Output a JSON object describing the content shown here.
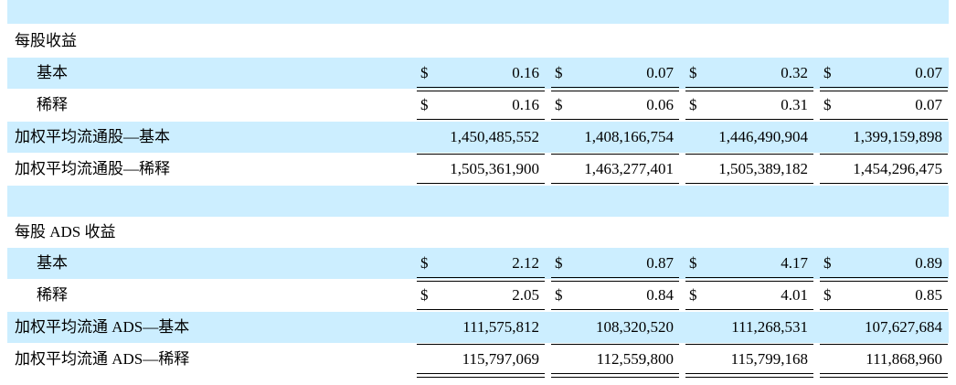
{
  "sections": [
    {
      "title": "每股收益",
      "rows": [
        {
          "label": "基本",
          "currency": "$",
          "values": [
            "0.16",
            "0.07",
            "0.32",
            "0.07"
          ]
        },
        {
          "label": "稀释",
          "currency": "$",
          "values": [
            "0.16",
            "0.06",
            "0.31",
            "0.07"
          ]
        },
        {
          "label": "加权平均流通股—基本",
          "currency": "",
          "values": [
            "1,450,485,552",
            "1,408,166,754",
            "1,446,490,904",
            "1,399,159,898"
          ]
        },
        {
          "label": "加权平均流通股—稀释",
          "currency": "",
          "values": [
            "1,505,361,900",
            "1,463,277,401",
            "1,505,389,182",
            "1,454,296,475"
          ]
        }
      ]
    },
    {
      "title": "每股 ADS 收益",
      "rows": [
        {
          "label": "基本",
          "currency": "$",
          "values": [
            "2.12",
            "0.87",
            "4.17",
            "0.89"
          ]
        },
        {
          "label": "稀释",
          "currency": "$",
          "values": [
            "2.05",
            "0.84",
            "4.01",
            "0.85"
          ]
        },
        {
          "label": "加权平均流通 ADS—基本",
          "currency": "",
          "values": [
            "111,575,812",
            "108,320,520",
            "111,268,531",
            "107,627,684"
          ]
        },
        {
          "label": "加权平均流通 ADS—稀释",
          "currency": "",
          "values": [
            "115,797,069",
            "112,559,800",
            "115,799,168",
            "111,868,960"
          ]
        }
      ]
    }
  ],
  "colors": {
    "row_highlight": "#cceeff",
    "background": "#ffffff",
    "text": "#000000"
  }
}
